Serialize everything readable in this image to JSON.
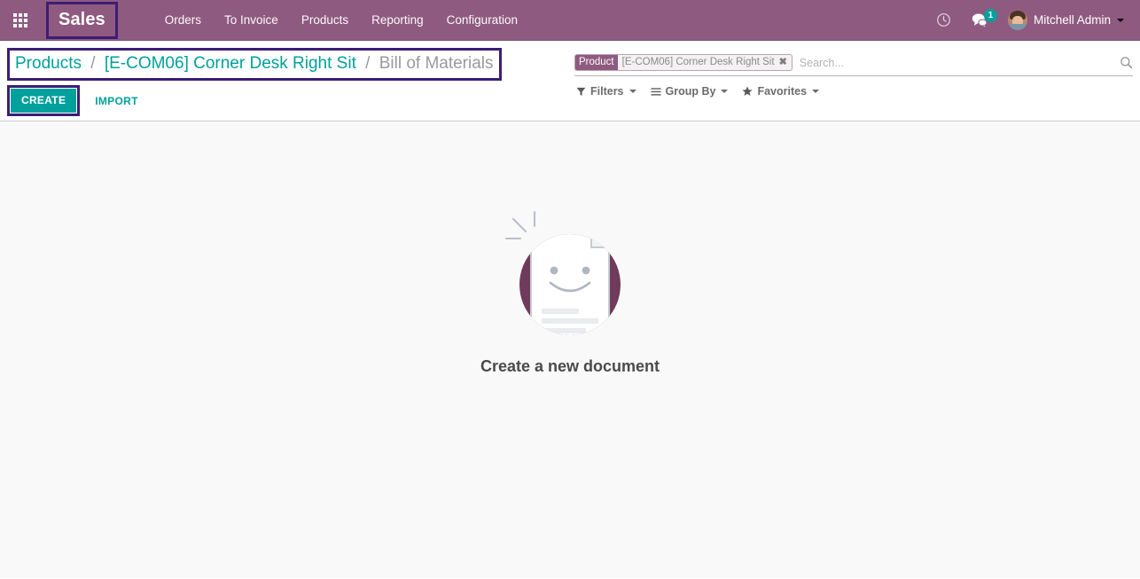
{
  "navbar": {
    "apps_icon": "apps-grid-icon",
    "brand": "Sales",
    "menu": [
      {
        "label": "Orders"
      },
      {
        "label": "To Invoice"
      },
      {
        "label": "Products"
      },
      {
        "label": "Reporting"
      },
      {
        "label": "Configuration"
      }
    ],
    "activity_icon": "clock-icon",
    "messages_icon": "chat-bubbles-icon",
    "messages_count": "1",
    "user_name": "Mitchell Admin",
    "background_color": "#8f5a80",
    "accent_color": "#00a09d"
  },
  "breadcrumb": {
    "items": [
      {
        "label": "Products",
        "type": "link"
      },
      {
        "label": "[E-COM06] Corner Desk Right Sit",
        "type": "link"
      },
      {
        "label": "Bill of Materials",
        "type": "active"
      }
    ],
    "separator": "/"
  },
  "toolbar": {
    "create_label": "CREATE",
    "import_label": "IMPORT"
  },
  "search": {
    "facet_label": "Product",
    "facet_value": "[E-COM06] Corner Desk Right Sit",
    "facet_remove_icon": "close-icon",
    "placeholder": "Search...",
    "value": "",
    "search_icon": "search-icon"
  },
  "filters": {
    "filters_label": "Filters",
    "filters_icon": "funnel-icon",
    "group_by_label": "Group By",
    "group_by_icon": "list-lines-icon",
    "favorites_label": "Favorites",
    "favorites_icon": "star-icon"
  },
  "empty_state": {
    "title": "Create a new document",
    "illustration": "smiling-document-icon",
    "circle_color": "#6f3a5b"
  }
}
